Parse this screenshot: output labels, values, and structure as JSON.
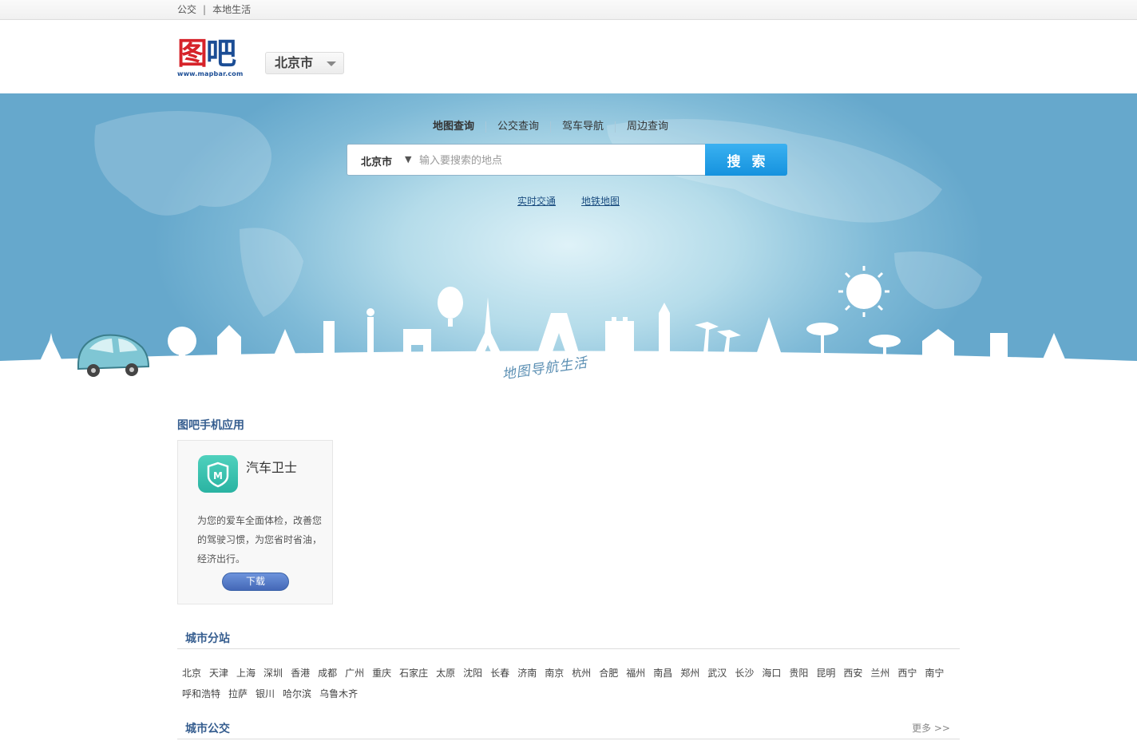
{
  "topbar": {
    "links": [
      "公交",
      "本地生活"
    ],
    "separator": "|"
  },
  "header": {
    "logo_cn_a": "图",
    "logo_cn_b": "吧",
    "logo_en": "www.mapbar.com",
    "city": "北京市"
  },
  "hero": {
    "tabs": [
      "地图查询",
      "公交查询",
      "驾车导航",
      "周边查询"
    ],
    "search": {
      "city": "北京市",
      "dropdown_glyph": "▼",
      "placeholder": "输入要搜索的地点",
      "button": "搜索"
    },
    "quicklinks": [
      "实时交通",
      "地铁地图"
    ],
    "slogan": "地图导航生活"
  },
  "apps": {
    "title": "图吧手机应用",
    "card": {
      "name": "汽车卫士",
      "icon": "shield-m-icon",
      "description": "为您的爱车全面体检，改善您的驾驶习惯，为您省时省油，经济出行。",
      "button": "下载"
    }
  },
  "cities": {
    "title": "城市分站",
    "items": [
      "北京",
      "天津",
      "上海",
      "深圳",
      "香港",
      "成都",
      "广州",
      "重庆",
      "石家庄",
      "太原",
      "沈阳",
      "长春",
      "济南",
      "南京",
      "杭州",
      "合肥",
      "福州",
      "南昌",
      "郑州",
      "武汉",
      "长沙",
      "海口",
      "贵阳",
      "昆明",
      "西安",
      "兰州",
      "西宁",
      "南宁",
      "呼和浩特",
      "拉萨",
      "银川",
      "哈尔滨",
      "乌鲁木齐"
    ]
  },
  "bus": {
    "title": "城市公交",
    "more": "更多 >>"
  },
  "colors": {
    "accent": "#1592de",
    "section_title": "#355d8f",
    "logo_red": "#d6232a",
    "logo_blue": "#1b4d95"
  }
}
